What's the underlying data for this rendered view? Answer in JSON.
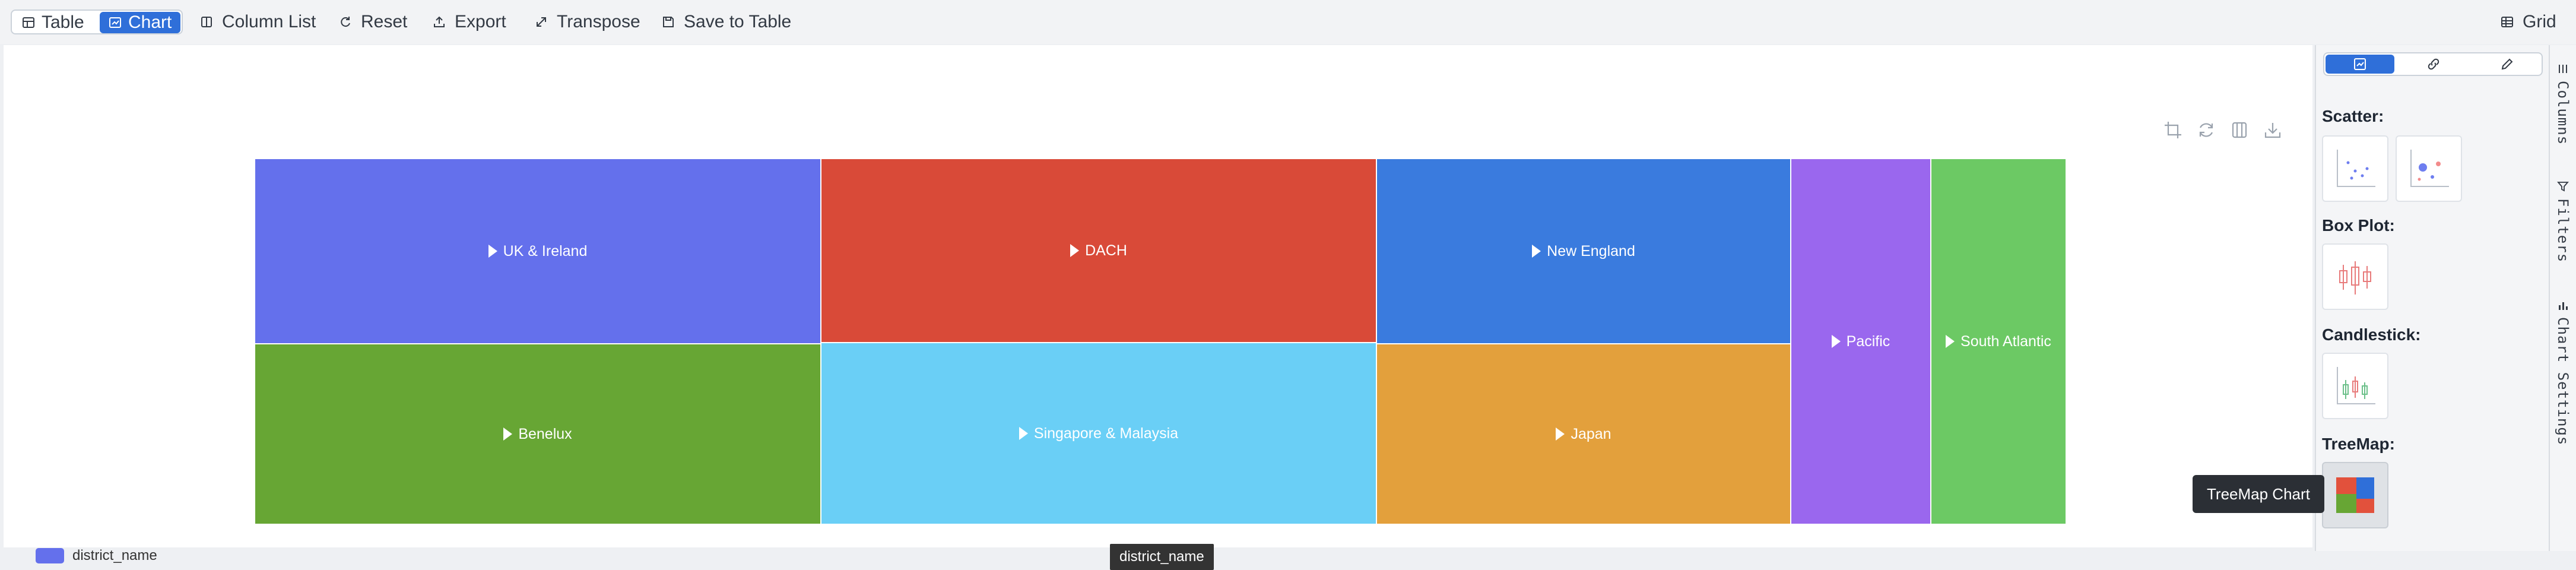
{
  "toolbar": {
    "table_label": "Table",
    "chart_label": "Chart",
    "column_list_label": "Column List",
    "reset_label": "Reset",
    "export_label": "Export",
    "transpose_label": "Transpose",
    "save_to_table_label": "Save to Table",
    "grid_label": "Grid"
  },
  "chart_data": {
    "type": "treemap",
    "legend": "district_name",
    "axis_tag": "district_name",
    "cells": [
      {
        "label": "UK & Ireland",
        "color": "#6470ec"
      },
      {
        "label": "Benelux",
        "color": "#67a634"
      },
      {
        "label": "DACH",
        "color": "#d94a38"
      },
      {
        "label": "Singapore & Malaysia",
        "color": "#6acff6"
      },
      {
        "label": "New England",
        "color": "#3a7bde"
      },
      {
        "label": "Japan",
        "color": "#e3a03c"
      },
      {
        "label": "Pacific",
        "color": "#9a67ee"
      },
      {
        "label": "South Atlantic",
        "color": "#6cc964"
      }
    ]
  },
  "tooltip": "TreeMap Chart",
  "sidebar": {
    "sections": {
      "scatter": "Scatter:",
      "box_plot": "Box Plot:",
      "candlestick": "Candlestick:",
      "treemap": "TreeMap:"
    }
  },
  "vertical_tabs": {
    "columns": "Columns",
    "filters": "Filters",
    "chart_settings": "Chart Settings"
  },
  "colors": {
    "accent": "#2f6fd9"
  }
}
